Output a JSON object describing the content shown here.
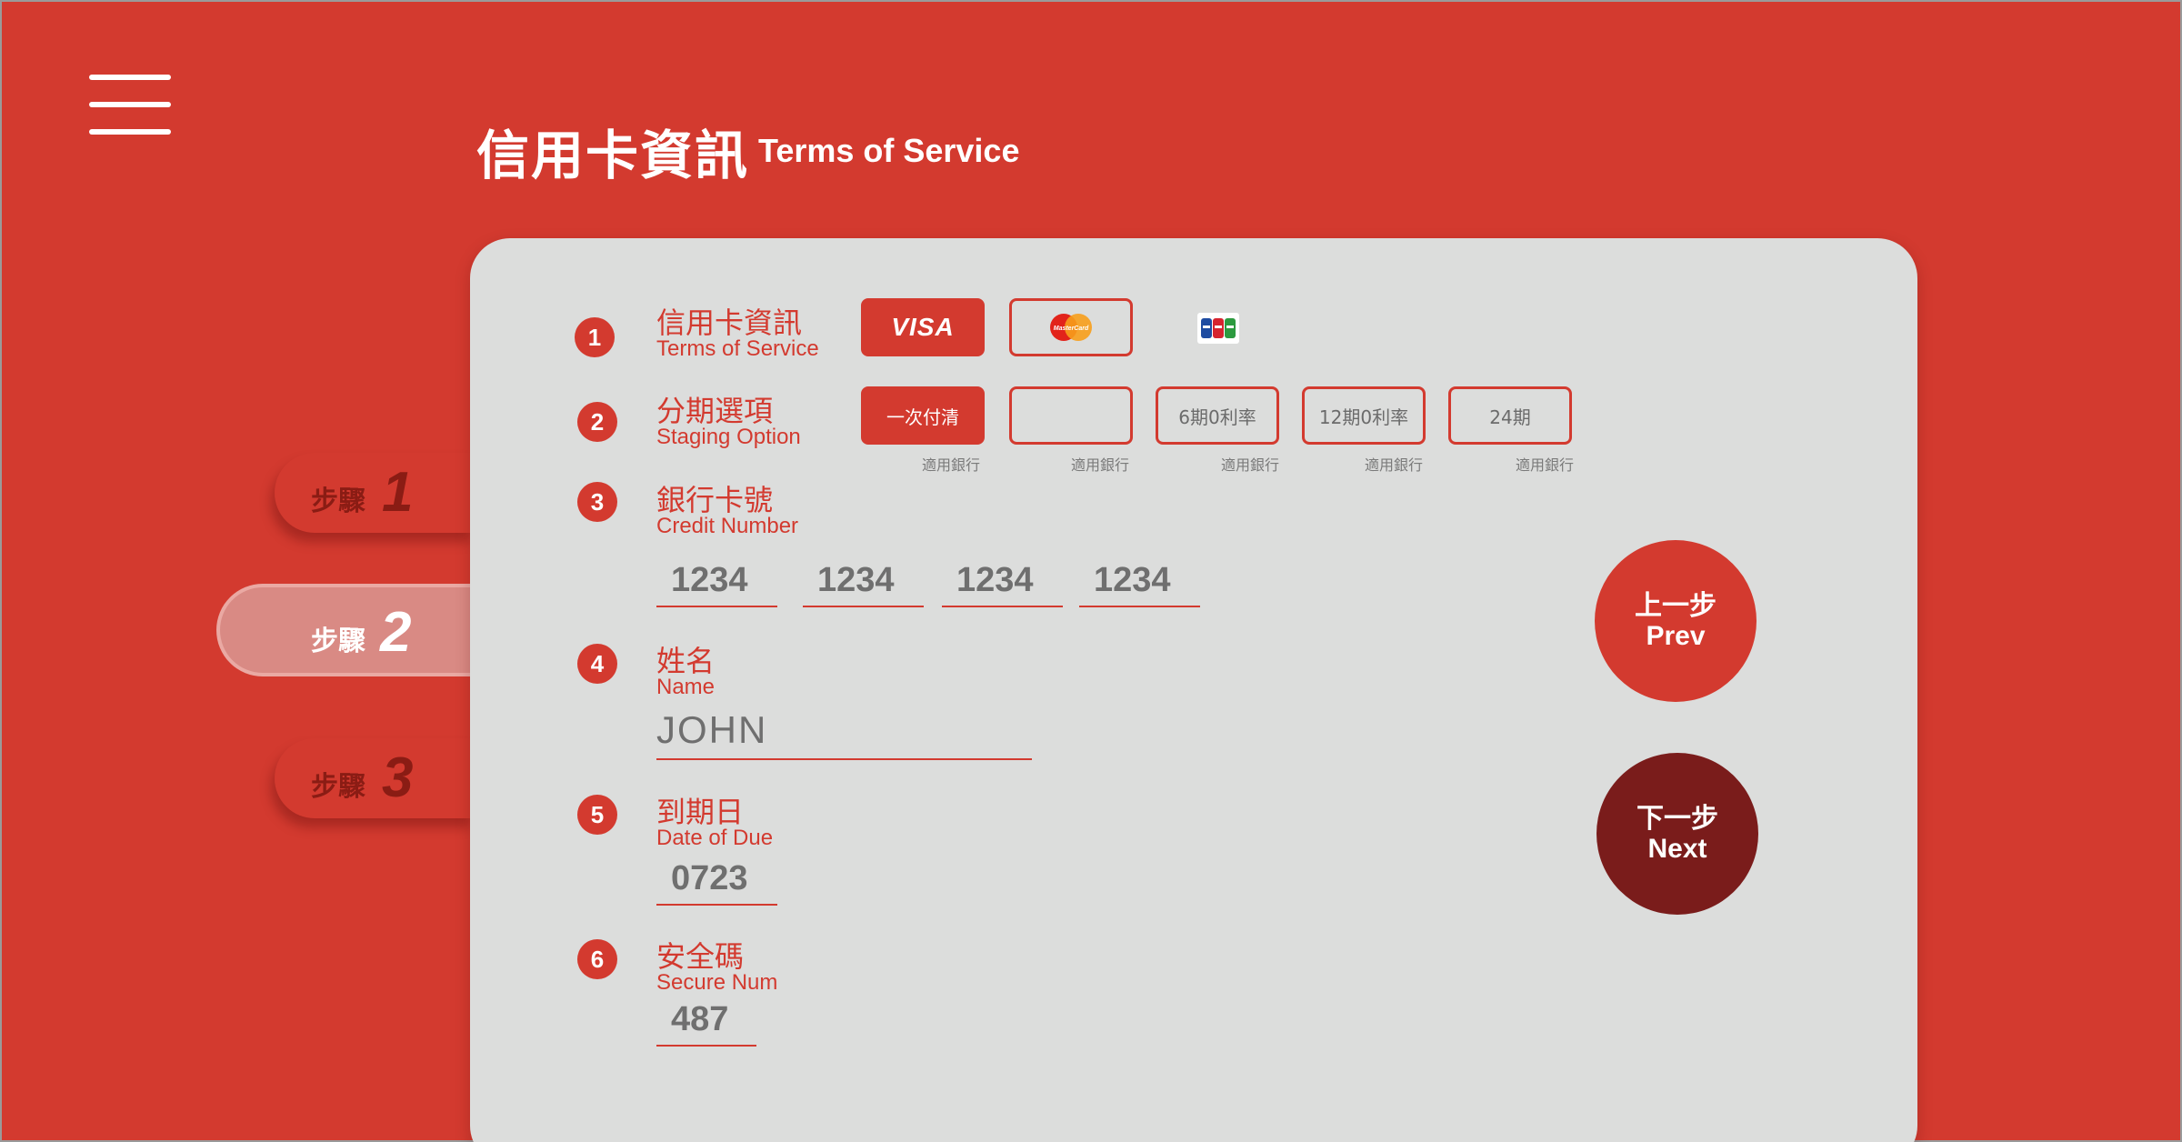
{
  "header": {
    "title": "信用卡資訊",
    "subtitle": "Terms of Service"
  },
  "steps": [
    {
      "label": "步驟",
      "number": "1"
    },
    {
      "label": "步驟",
      "number": "2"
    },
    {
      "label": "步驟",
      "number": "3"
    }
  ],
  "rows": [
    {
      "num": "1",
      "zh": "信用卡資訊",
      "en": "Terms of Service"
    },
    {
      "num": "2",
      "zh": "分期選項",
      "en": "Staging Option"
    },
    {
      "num": "3",
      "zh": "銀行卡號",
      "en": "Credit Number"
    },
    {
      "num": "4",
      "zh": "姓名",
      "en": "Name"
    },
    {
      "num": "5",
      "zh": "到期日",
      "en": "Date of Due"
    },
    {
      "num": "6",
      "zh": "安全碼",
      "en": "Secure Num"
    }
  ],
  "cards": {
    "visa": "VISA",
    "mastercard": "MasterCard"
  },
  "options": [
    {
      "label": "一次付清",
      "note": "適用銀行"
    },
    {
      "label": "",
      "note": "適用銀行"
    },
    {
      "label": "6期0利率",
      "note": "適用銀行"
    },
    {
      "label": "12期0利率",
      "note": "適用銀行"
    },
    {
      "label": "24期",
      "note": "適用銀行"
    }
  ],
  "credit_number": [
    "1234",
    "1234",
    "1234",
    "1234"
  ],
  "name_value": "JOHN",
  "due_value": "0723",
  "secure_value": "487",
  "buttons": {
    "prev_zh": "上一步",
    "prev_en": "Prev",
    "next_zh": "下一步",
    "next_en": "Next"
  },
  "colors": {
    "primary": "#d33a2f",
    "dark": "#7a1c1b",
    "card_bg": "#dcdddc"
  }
}
